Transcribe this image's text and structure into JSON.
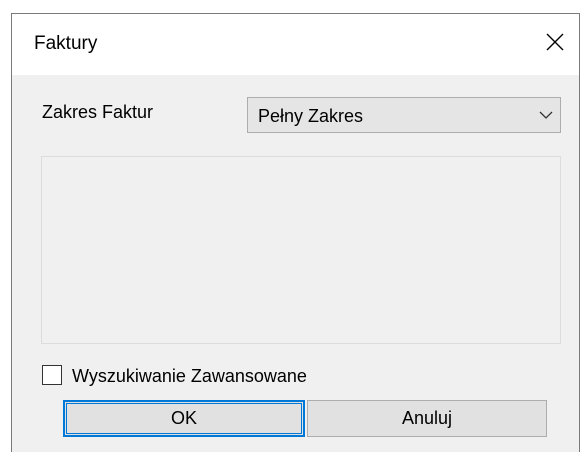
{
  "dialog": {
    "title": "Faktury",
    "close_icon": "close-icon"
  },
  "range": {
    "label": "Zakres Faktur",
    "selected": "Pełny Zakres",
    "arrow_icon": "chevron-down-icon"
  },
  "advanced_search": {
    "label": "Wyszukiwanie Zawansowane",
    "checked": false
  },
  "buttons": {
    "ok": "OK",
    "cancel": "Anuluj"
  },
  "colors": {
    "accent": "#0078d7",
    "dialog_bg": "#f0f0f0",
    "titlebar_bg": "#ffffff"
  }
}
